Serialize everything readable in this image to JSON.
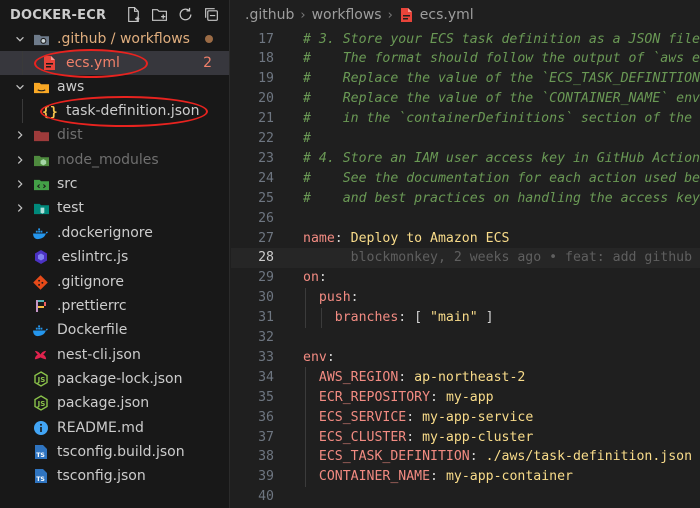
{
  "explorer": {
    "title": "DOCKER-ECR",
    "actions": [
      "new-file-icon",
      "new-folder-icon",
      "refresh-icon",
      "collapse-all-icon"
    ],
    "tree": [
      {
        "label": ".github / workflows",
        "type": "folder",
        "open": true,
        "state": "modified",
        "badge": "dot"
      },
      {
        "label": "ecs.yml",
        "type": "file",
        "icon": "yaml-file-icon",
        "state": "error",
        "badge": "2"
      },
      {
        "label": "aws",
        "type": "folder",
        "open": true,
        "state": "normal"
      },
      {
        "label": "task-definition.json",
        "type": "file",
        "icon": "json-file-icon",
        "state": "normal"
      },
      {
        "label": "dist",
        "type": "folder",
        "open": false,
        "state": "dim"
      },
      {
        "label": "node_modules",
        "type": "folder",
        "open": false,
        "state": "dim"
      },
      {
        "label": "src",
        "type": "folder",
        "open": false,
        "state": "normal"
      },
      {
        "label": "test",
        "type": "folder",
        "open": false,
        "state": "normal"
      },
      {
        "label": ".dockerignore",
        "type": "file",
        "icon": "docker-icon",
        "state": "normal"
      },
      {
        "label": ".eslintrc.js",
        "type": "file",
        "icon": "eslint-icon",
        "state": "normal"
      },
      {
        "label": ".gitignore",
        "type": "file",
        "icon": "git-icon",
        "state": "normal"
      },
      {
        "label": ".prettierrc",
        "type": "file",
        "icon": "prettier-icon",
        "state": "normal"
      },
      {
        "label": "Dockerfile",
        "type": "file",
        "icon": "docker-icon",
        "state": "normal"
      },
      {
        "label": "nest-cli.json",
        "type": "file",
        "icon": "nest-icon",
        "state": "normal"
      },
      {
        "label": "package-lock.json",
        "type": "file",
        "icon": "npm-json-icon",
        "state": "normal"
      },
      {
        "label": "package.json",
        "type": "file",
        "icon": "npm-json-icon",
        "state": "normal"
      },
      {
        "label": "README.md",
        "type": "file",
        "icon": "info-icon",
        "state": "normal"
      },
      {
        "label": "tsconfig.build.json",
        "type": "file",
        "icon": "tsconfig-icon",
        "state": "normal"
      },
      {
        "label": "tsconfig.json",
        "type": "file",
        "icon": "tsconfig-icon",
        "state": "normal"
      }
    ]
  },
  "breadcrumb": [
    ".github",
    "workflows",
    "ecs.yml"
  ],
  "code": [
    {
      "n": "17",
      "parts": [
        {
          "t": "# 3. Store your ECS task definition as a JSON file",
          "c": "comment"
        }
      ]
    },
    {
      "n": "18",
      "parts": [
        {
          "t": "#    The format should follow the output of `aws e",
          "c": "comment"
        }
      ]
    },
    {
      "n": "19",
      "parts": [
        {
          "t": "#    Replace the value of the `ECS_TASK_DEFINITION",
          "c": "comment"
        }
      ]
    },
    {
      "n": "20",
      "parts": [
        {
          "t": "#    Replace the value of the `CONTAINER_NAME` env",
          "c": "comment"
        }
      ]
    },
    {
      "n": "21",
      "parts": [
        {
          "t": "#    in the `containerDefinitions` section of the",
          "c": "comment"
        }
      ]
    },
    {
      "n": "22",
      "parts": [
        {
          "t": "#",
          "c": "comment"
        }
      ]
    },
    {
      "n": "23",
      "parts": [
        {
          "t": "# 4. Store an IAM user access key in GitHub Action",
          "c": "comment"
        }
      ]
    },
    {
      "n": "24",
      "parts": [
        {
          "t": "#    See the documentation for each action used be",
          "c": "comment"
        }
      ]
    },
    {
      "n": "25",
      "parts": [
        {
          "t": "#    and best practices on handling the access key",
          "c": "comment"
        }
      ]
    },
    {
      "n": "26",
      "parts": []
    },
    {
      "n": "27",
      "parts": [
        {
          "t": "name",
          "c": "key"
        },
        {
          "t": ": ",
          "c": "plain"
        },
        {
          "t": "Deploy to Amazon ECS",
          "c": "str"
        }
      ]
    },
    {
      "n": "28",
      "current": true,
      "parts": [
        {
          "t": "      blockmonkey, 2 weeks ago • feat: add github",
          "c": "blame"
        }
      ]
    },
    {
      "n": "29",
      "parts": [
        {
          "t": "on",
          "c": "key"
        },
        {
          "t": ":",
          "c": "plain"
        }
      ]
    },
    {
      "n": "30",
      "indent": 1,
      "parts": [
        {
          "t": "  push",
          "c": "key"
        },
        {
          "t": ":",
          "c": "plain"
        }
      ]
    },
    {
      "n": "31",
      "indent": 2,
      "parts": [
        {
          "t": "    branches",
          "c": "key"
        },
        {
          "t": ": [ ",
          "c": "plain"
        },
        {
          "t": "\"main\"",
          "c": "str"
        },
        {
          "t": " ]",
          "c": "plain"
        }
      ]
    },
    {
      "n": "32",
      "parts": []
    },
    {
      "n": "33",
      "parts": [
        {
          "t": "env",
          "c": "key"
        },
        {
          "t": ":",
          "c": "plain"
        }
      ]
    },
    {
      "n": "34",
      "indent": 1,
      "parts": [
        {
          "t": "  AWS_REGION",
          "c": "key"
        },
        {
          "t": ": ",
          "c": "plain"
        },
        {
          "t": "ap-northeast-2",
          "c": "str"
        }
      ]
    },
    {
      "n": "35",
      "indent": 1,
      "parts": [
        {
          "t": "  ECR_REPOSITORY",
          "c": "key"
        },
        {
          "t": ": ",
          "c": "plain"
        },
        {
          "t": "my-app",
          "c": "str"
        }
      ]
    },
    {
      "n": "36",
      "indent": 1,
      "parts": [
        {
          "t": "  ECS_SERVICE",
          "c": "key"
        },
        {
          "t": ": ",
          "c": "plain"
        },
        {
          "t": "my-app-service",
          "c": "str"
        }
      ]
    },
    {
      "n": "37",
      "indent": 1,
      "parts": [
        {
          "t": "  ECS_CLUSTER",
          "c": "key"
        },
        {
          "t": ": ",
          "c": "plain"
        },
        {
          "t": "my-app-cluster",
          "c": "str"
        }
      ]
    },
    {
      "n": "38",
      "indent": 1,
      "parts": [
        {
          "t": "  ECS_TASK_DEFINITION",
          "c": "key"
        },
        {
          "t": ": ",
          "c": "plain"
        },
        {
          "t": "./aws/task-definition.json",
          "c": "str"
        }
      ]
    },
    {
      "n": "39",
      "indent": 1,
      "parts": [
        {
          "t": "  CONTAINER_NAME",
          "c": "key"
        },
        {
          "t": ": ",
          "c": "plain"
        },
        {
          "t": "my-app-container",
          "c": "str"
        }
      ]
    },
    {
      "n": "40",
      "parts": []
    }
  ],
  "colors": {
    "sidebar_bg": "#181818",
    "editor_bg": "#1f1f1f",
    "active_row": "#37373d",
    "annotation_red": "#e8231f",
    "yaml_key": "#f28b82",
    "yaml_string": "#f9dc8a",
    "comment": "#6a9955"
  }
}
